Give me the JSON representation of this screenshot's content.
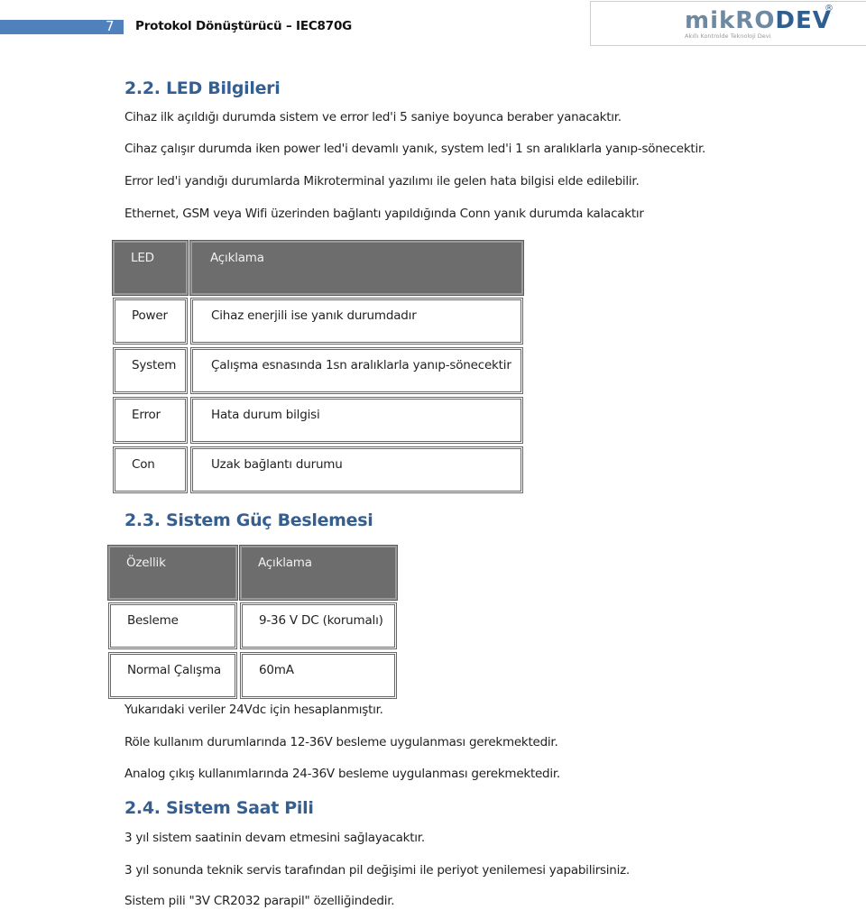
{
  "header": {
    "page_number": "7",
    "title": "Protokol Dönüştürücü – IEC870G",
    "accent_color": "#4f81bd"
  },
  "logo": {
    "brand_part1": "mikRO",
    "brand_part2": "DEV",
    "registered": "®",
    "tagline": "Akıllı Kontrolde Teknoloji Devi"
  },
  "sections": [
    {
      "heading": "2.2. LED Bilgileri",
      "paragraphs": [
        "Cihaz ilk açıldığı durumda sistem ve error led'i 5 saniye boyunca beraber yanacaktır.",
        "Cihaz çalışır durumda iken power led'i devamlı yanık, system led'i 1 sn aralıklarla yanıp-sönecektir.",
        "Error led'i yandığı durumlarda Mikroterminal yazılımı ile gelen hata bilgisi elde edilebilir.",
        "Ethernet, GSM veya Wifi üzerinden bağlantı yapıldığında Conn yanık durumda kalacaktır"
      ],
      "table": {
        "headers": [
          "LED",
          "Açıklama"
        ],
        "rows": [
          [
            "Power",
            "Cihaz enerjili ise yanık durumdadır"
          ],
          [
            "System",
            "Çalışma esnasında 1sn aralıklarla yanıp-sönecektir"
          ],
          [
            "Error",
            "Hata durum bilgisi"
          ],
          [
            "Con",
            "Uzak bağlantı durumu"
          ]
        ]
      }
    },
    {
      "heading": "2.3.  Sistem Güç Beslemesi",
      "table": {
        "headers": [
          "Özellik",
          "Açıklama"
        ],
        "rows": [
          [
            "Besleme",
            "9-36 V DC (korumalı)"
          ],
          [
            "Normal Çalışma",
            "60mA"
          ]
        ]
      },
      "paragraphs": [
        "Yukarıdaki veriler 24Vdc için hesaplanmıştır.",
        "Röle kullanım durumlarında 12-36V besleme uygulanması gerekmektedir.",
        "Analog çıkış kullanımlarında 24-36V besleme uygulanması gerekmektedir."
      ]
    },
    {
      "heading": "2.4. Sistem Saat Pili",
      "paragraphs": [
        "3 yıl sistem saatinin devam etmesini sağlayacaktır.",
        "3 yıl sonunda teknik servis tarafından pil değişimi ile periyot yenilemesi yapabilirsiniz.",
        "Sistem pili \"3V CR2032 parapil\" özelliğindedir."
      ]
    }
  ]
}
